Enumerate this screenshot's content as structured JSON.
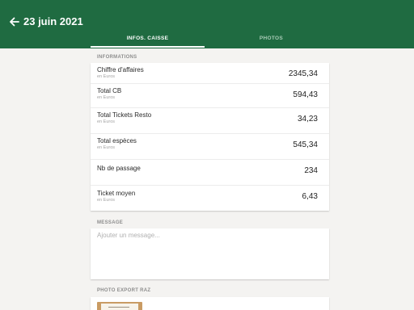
{
  "header": {
    "title": "23 juin 2021",
    "tabs": [
      {
        "label": "INFOS. CAISSE",
        "active": true
      },
      {
        "label": "PHOTOS",
        "active": false
      }
    ],
    "color": "#1f6b41"
  },
  "informations": {
    "section_title": "INFORMATIONS",
    "rows": [
      {
        "label": "Chiffre d'affaires",
        "sub": "en Euros",
        "value": "2345,34"
      },
      {
        "label": "Total CB",
        "sub": "en Euros",
        "value": "594,43"
      },
      {
        "label": "Total Tickets Resto",
        "sub": "en Euros",
        "value": "34,23"
      },
      {
        "label": "Total espèces",
        "sub": "en Euros",
        "value": "545,34"
      },
      {
        "label": "Nb de passage",
        "sub": "",
        "value": "234"
      },
      {
        "label": "Ticket moyen",
        "sub": "en Euros",
        "value": "6,43"
      }
    ]
  },
  "message": {
    "section_title": "MESSAGE",
    "placeholder": "Ajouter un message..."
  },
  "photo_export": {
    "section_title": "PHOTO EXPORT RAZ"
  },
  "icons": {
    "back": "arrow-left-icon"
  }
}
